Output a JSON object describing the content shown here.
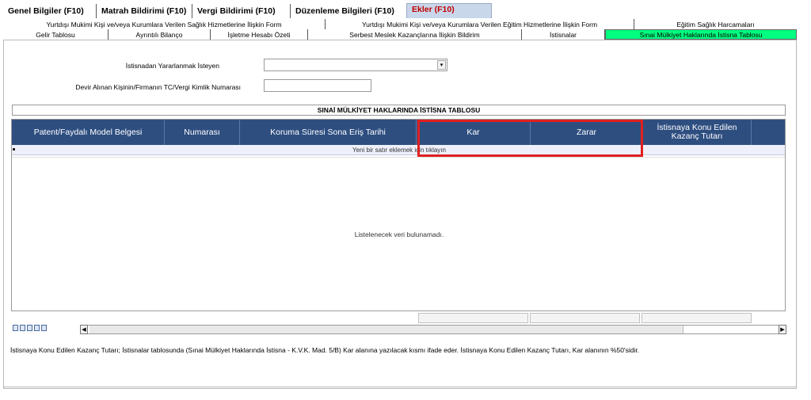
{
  "top_tabs": [
    {
      "label": "Genel Bilgiler (F10)",
      "active": false
    },
    {
      "label": "Matrah Bildirimi (F10)",
      "active": false
    },
    {
      "label": "Vergi Bildirimi (F10)",
      "active": false
    },
    {
      "label": "Düzenleme Bilgileri  (F10)",
      "active": false
    },
    {
      "label": "Ekler (F10)",
      "active": true
    }
  ],
  "sub_tabs_row1": [
    {
      "label": "Yurtdışı Mukimi Kişi ve/veya Kurumlara Verilen Sağlık Hizmetlerine İlişkin Form"
    },
    {
      "label": "Yurtdışı Mukimi Kişi ve/veya Kurumlara Verilen Eğitim Hizmetlerine İlişkin Form"
    },
    {
      "label": "Eğitim Sağlık Harcamaları"
    }
  ],
  "sub_tabs_row2": [
    {
      "label": "Gelir Tablosu"
    },
    {
      "label": "Ayrıntılı Bilanço"
    },
    {
      "label": "İşletme Hesabı Özeti"
    },
    {
      "label": "Serbest Meslek Kazançlarına İlişkin Bildirim"
    },
    {
      "label": "İstisnalar"
    },
    {
      "label": "Sınai Mülkiyet Haklarında İstisna Tablosu"
    }
  ],
  "form": {
    "beneficiary_label": "İstisnadan Yararlanmak İsteyen",
    "beneficiary_value": "",
    "taxid_label": "Devir Alınan Kişinin/Firmanın TC/Vergi Kimlik Numarası",
    "taxid_value": ""
  },
  "table": {
    "title": "SINAİ MÜLKİYET HAKLARINDA İSTİSNA TABLOSU",
    "columns": [
      "Patent/Faydalı Model Belgesi",
      "Numarası",
      "Koruma Süresi Sona Eriş Tarihi",
      "Kar",
      "Zarar",
      "İstisnaya Konu Edilen Kazanç Tutarı"
    ],
    "add_row_text": "Yeni bir satır eklemek için tıklayın",
    "empty_text": "Listelenecek veri bulunamadı."
  },
  "toolbar_icons": [
    "save-icon",
    "view-icon",
    "filter-icon",
    "export-icon",
    "print-icon"
  ],
  "scrollbar": {
    "left_arrow": "◀",
    "right_arrow": "▶"
  },
  "note": "İstisnaya Konu Edilen Kazanç Tutarı; İstisnalar tablosunda (Sınai Mülkiyet Haklarında İstisna - K.V.K. Mad. 5/B) Kar alanına yazılacak kısmı ifade eder. İstisnaya Konu Edilen Kazanç Tutarı, Kar alanının %50'sidir.",
  "colors": {
    "header_bg": "#2e4e80",
    "active_subtab": "#00ff80",
    "highlight_border": "#e02020",
    "active_toptab_text": "#c00000"
  }
}
